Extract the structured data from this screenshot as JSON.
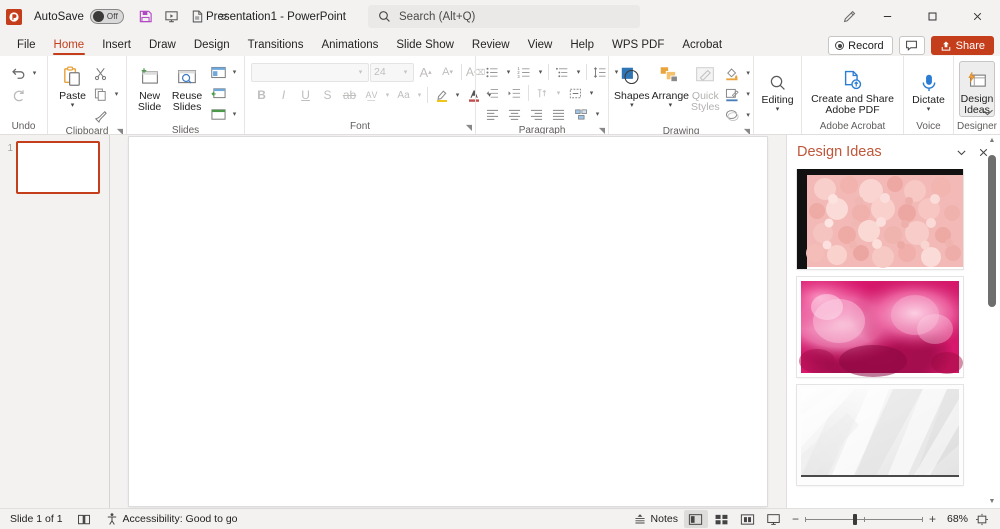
{
  "titlebar": {
    "app_logo": "powerpoint-logo",
    "autosave_label": "AutoSave",
    "autosave_state": "Off",
    "document_title": "Presentation1  -  PowerPoint",
    "quick_access": [
      {
        "name": "save-button",
        "icon": "save-icon"
      },
      {
        "name": "start-from-beginning-button",
        "icon": "present-icon"
      },
      {
        "name": "export-pdf-button",
        "icon": "pdf-icon"
      },
      {
        "name": "customize-quick-access-toolbar",
        "icon": "chevron-down-icon"
      }
    ],
    "search": {
      "placeholder": "Search (Alt+Q)",
      "icon": "search-icon"
    },
    "ink_button": "pen-icon",
    "window_controls": {
      "minimize": "–",
      "maximize": "❐",
      "close": "✕"
    }
  },
  "tabs": [
    {
      "label": "File",
      "active": false
    },
    {
      "label": "Home",
      "active": true
    },
    {
      "label": "Insert",
      "active": false
    },
    {
      "label": "Draw",
      "active": false
    },
    {
      "label": "Design",
      "active": false
    },
    {
      "label": "Transitions",
      "active": false
    },
    {
      "label": "Animations",
      "active": false
    },
    {
      "label": "Slide Show",
      "active": false
    },
    {
      "label": "Review",
      "active": false
    },
    {
      "label": "View",
      "active": false
    },
    {
      "label": "Help",
      "active": false
    },
    {
      "label": "WPS PDF",
      "active": false
    },
    {
      "label": "Acrobat",
      "active": false
    }
  ],
  "tabstrip_right": {
    "record_label": "Record",
    "comments_icon": "comment-icon",
    "share_label": "Share",
    "share_color": "#c43e1c"
  },
  "ribbon": {
    "collapse_icon": "chevron-up-icon",
    "groups": [
      {
        "name": "Undo",
        "label": "Undo",
        "buttons": [
          {
            "name": "undo-button",
            "icon": "undo-arrow-icon"
          },
          {
            "name": "redo-button",
            "icon": "redo-arrow-icon"
          }
        ]
      },
      {
        "name": "Clipboard",
        "label": "Clipboard",
        "dialog_launcher": true,
        "buttons": [
          {
            "name": "paste-button",
            "label": "Paste",
            "icon": "clipboard-icon"
          },
          {
            "name": "cut-button",
            "icon": "scissors-icon"
          },
          {
            "name": "copy-button",
            "icon": "copy-icon"
          },
          {
            "name": "format-painter-button",
            "icon": "paintbrush-icon"
          }
        ]
      },
      {
        "name": "Slides",
        "label": "Slides",
        "buttons": [
          {
            "name": "new-slide-button",
            "label": "New Slide",
            "icon": "new-slide-icon"
          },
          {
            "name": "reuse-slides-button",
            "label": "Reuse Slides",
            "icon": "reuse-slides-icon"
          },
          {
            "name": "layout-button",
            "icon": "layout-icon"
          },
          {
            "name": "reset-button",
            "icon": "reset-icon"
          },
          {
            "name": "section-button",
            "icon": "section-icon"
          }
        ]
      },
      {
        "name": "Font",
        "label": "Font",
        "dialog_launcher": true,
        "font_name_value": "",
        "font_size_value": "24",
        "disabled": true,
        "buttons": [
          {
            "name": "increase-font-size-button",
            "icon": "A-up-icon"
          },
          {
            "name": "decrease-font-size-button",
            "icon": "A-down-icon"
          },
          {
            "name": "clear-formatting-button",
            "icon": "clear-format-icon"
          },
          {
            "name": "bold-button",
            "icon": "bold-icon"
          },
          {
            "name": "italic-button",
            "icon": "italic-icon"
          },
          {
            "name": "underline-button",
            "icon": "underline-icon"
          },
          {
            "name": "text-shadow-button",
            "icon": "shadow-icon"
          },
          {
            "name": "strikethrough-button",
            "icon": "strikethrough-icon"
          },
          {
            "name": "character-spacing-button",
            "icon": "char-spacing-icon"
          },
          {
            "name": "change-case-button",
            "icon": "change-case-icon"
          },
          {
            "name": "text-highlight-color-button",
            "icon": "highlighter-icon"
          },
          {
            "name": "font-color-button",
            "icon": "font-color-icon"
          }
        ]
      },
      {
        "name": "Paragraph",
        "label": "Paragraph",
        "dialog_launcher": true,
        "buttons": [
          {
            "name": "bullets-button",
            "icon": "bullet-list-icon"
          },
          {
            "name": "numbering-button",
            "icon": "numbered-list-icon"
          },
          {
            "name": "multilevel-list-button",
            "icon": "multilevel-list-icon"
          },
          {
            "name": "line-spacing-button",
            "icon": "line-spacing-icon"
          },
          {
            "name": "decrease-indent-button",
            "icon": "decrease-indent-icon"
          },
          {
            "name": "increase-indent-button",
            "icon": "increase-indent-icon"
          },
          {
            "name": "text-direction-button",
            "icon": "text-direction-icon"
          },
          {
            "name": "align-text-button",
            "icon": "align-text-icon"
          },
          {
            "name": "convert-to-smartart-button",
            "icon": "smartart-icon"
          },
          {
            "name": "align-left-button",
            "icon": "align-left-icon"
          },
          {
            "name": "align-center-button",
            "icon": "align-center-icon"
          },
          {
            "name": "align-right-button",
            "icon": "align-right-icon"
          },
          {
            "name": "justify-button",
            "icon": "justify-icon"
          }
        ]
      },
      {
        "name": "Drawing",
        "label": "Drawing",
        "dialog_launcher": true,
        "buttons": [
          {
            "name": "shapes-button",
            "label": "Shapes",
            "icon": "shapes-icon"
          },
          {
            "name": "arrange-button",
            "label": "Arrange",
            "icon": "arrange-icon"
          },
          {
            "name": "quick-styles-button",
            "label": "Quick Styles",
            "icon": "quick-styles-icon",
            "disabled": true
          },
          {
            "name": "shape-fill-button",
            "icon": "shape-fill-icon"
          },
          {
            "name": "shape-outline-button",
            "icon": "shape-outline-icon"
          },
          {
            "name": "shape-effects-button",
            "icon": "shape-effects-icon"
          }
        ]
      },
      {
        "name": "Editing",
        "label": "",
        "buttons": [
          {
            "name": "editing-button",
            "label": "Editing",
            "icon": "magnifier-icon"
          }
        ]
      },
      {
        "name": "Adobe Acrobat",
        "label": "Adobe Acrobat",
        "buttons": [
          {
            "name": "create-and-share-adobe-pdf-button",
            "label": "Create and Share Adobe PDF",
            "icon": "adobe-pdf-icon"
          }
        ]
      },
      {
        "name": "Voice",
        "label": "Voice",
        "buttons": [
          {
            "name": "dictate-button",
            "label": "Dictate",
            "icon": "microphone-icon"
          }
        ]
      },
      {
        "name": "Designer",
        "label": "Designer",
        "buttons": [
          {
            "name": "design-ideas-button",
            "label": "Design Ideas",
            "icon": "design-ideas-icon",
            "active": true
          }
        ]
      }
    ]
  },
  "slide_panel": {
    "slides": [
      {
        "number": "1",
        "selected": true
      }
    ]
  },
  "design_ideas": {
    "title": "Design Ideas",
    "dropdown_icon": "chevron-down-icon",
    "close_icon": "close-icon",
    "cards": [
      {
        "name": "design-idea-pink-beads",
        "art": "beads",
        "alt": "Pink beads texture design"
      },
      {
        "name": "design-idea-pink-smoke",
        "art": "smoke",
        "alt": "Magenta pink smoke design"
      },
      {
        "name": "design-idea-white-folds",
        "art": "fold",
        "alt": "White abstract folds design"
      }
    ],
    "scroll_up_icon": "triangle-up-icon",
    "scroll_down_icon": "triangle-down-icon"
  },
  "statusbar": {
    "slide_counter": "Slide 1 of 1",
    "language_icon": "book-icon",
    "accessibility_icon": "accessibility-icon",
    "accessibility_text": "Accessibility: Good to go",
    "notes_label": "Notes",
    "notes_icon": "notes-icon",
    "views": [
      {
        "name": "normal-view-button",
        "icon": "normal-view-icon",
        "selected": true
      },
      {
        "name": "slide-sorter-button",
        "icon": "slide-sorter-icon",
        "selected": false
      },
      {
        "name": "reading-view-button",
        "icon": "reading-view-icon",
        "selected": false
      },
      {
        "name": "slide-show-button",
        "icon": "slide-show-icon",
        "selected": false
      }
    ],
    "zoom_out": "−",
    "zoom_in": "+",
    "zoom_level": "68%",
    "fit_icon": "fit-to-window-icon"
  }
}
